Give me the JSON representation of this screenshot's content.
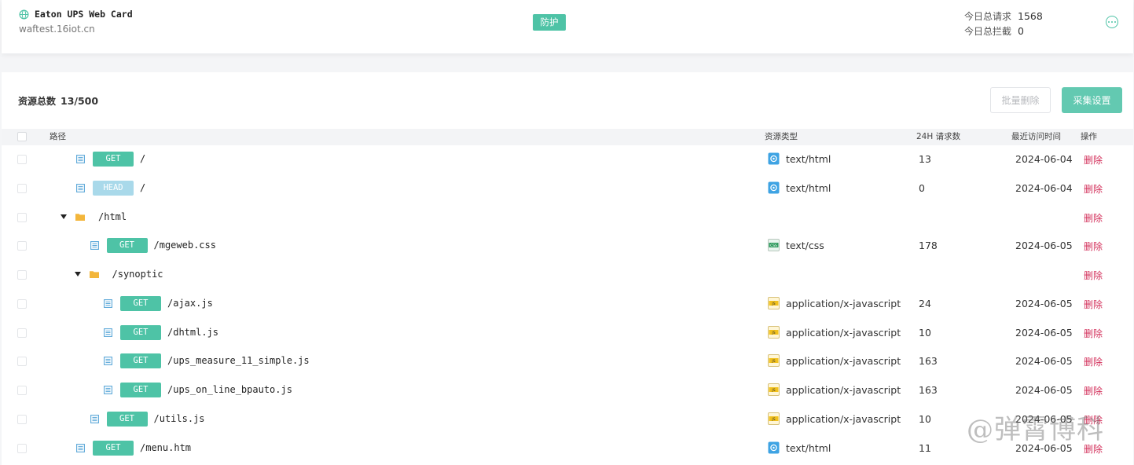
{
  "site": {
    "name": "Eaton UPS Web Card",
    "domain": "waftest.16iot.cn",
    "mode_badge": "防护",
    "stats": [
      {
        "label": "今日总请求",
        "value": "1568"
      },
      {
        "label": "今日总拦截",
        "value": "0"
      }
    ],
    "accent_color": "#4ec3a6"
  },
  "resources": {
    "total_label": "资源总数",
    "total_value": "13/500",
    "batch_delete_label": "批量删除",
    "collect_settings_label": "采集设置"
  },
  "table": {
    "headers": {
      "path": "路径",
      "type": "资源类型",
      "requests": "24H 请求数",
      "last_access": "最近访问时间",
      "actions": "操作"
    },
    "rows": [
      {
        "kind": "file",
        "method": "GET",
        "path": "/",
        "type": "text/html",
        "type_icon": "html-icon",
        "requests": "13",
        "last_access": "2024-06-04",
        "action": "删除"
      },
      {
        "kind": "file",
        "method": "HEAD",
        "path": "/",
        "type": "text/html",
        "type_icon": "html-icon",
        "requests": "0",
        "last_access": "2024-06-04",
        "action": "删除"
      },
      {
        "kind": "folder",
        "path": "/html",
        "action": "删除"
      },
      {
        "kind": "file",
        "method": "GET",
        "path": "/mgeweb.css",
        "type": "text/css",
        "type_icon": "css-icon",
        "requests": "178",
        "last_access": "2024-06-05",
        "action": "删除"
      },
      {
        "kind": "folder",
        "path": "/synoptic",
        "action": "删除"
      },
      {
        "kind": "file",
        "method": "GET",
        "path": "/ajax.js",
        "type": "application/x-javascript",
        "type_icon": "js-icon",
        "requests": "24",
        "last_access": "2024-06-05",
        "action": "删除"
      },
      {
        "kind": "file",
        "method": "GET",
        "path": "/dhtml.js",
        "type": "application/x-javascript",
        "type_icon": "js-icon",
        "requests": "10",
        "last_access": "2024-06-05",
        "action": "删除"
      },
      {
        "kind": "file",
        "method": "GET",
        "path": "/ups_measure_11_simple.js",
        "type": "application/x-javascript",
        "type_icon": "js-icon",
        "requests": "163",
        "last_access": "2024-06-05",
        "action": "删除"
      },
      {
        "kind": "file",
        "method": "GET",
        "path": "/ups_on_line_bpauto.js",
        "type": "application/x-javascript",
        "type_icon": "js-icon",
        "requests": "163",
        "last_access": "2024-06-05",
        "action": "删除"
      },
      {
        "kind": "file",
        "method": "GET",
        "path": "/utils.js",
        "type": "application/x-javascript",
        "type_icon": "js-icon",
        "requests": "10",
        "last_access": "2024-06-05",
        "action": "删除"
      },
      {
        "kind": "file",
        "method": "GET",
        "path": "/menu.htm",
        "type": "text/html",
        "type_icon": "html-icon",
        "requests": "11",
        "last_access": "2024-06-05",
        "action": "删除"
      }
    ]
  },
  "watermark": "@弹霄博科",
  "delete_color": "#d3305b"
}
